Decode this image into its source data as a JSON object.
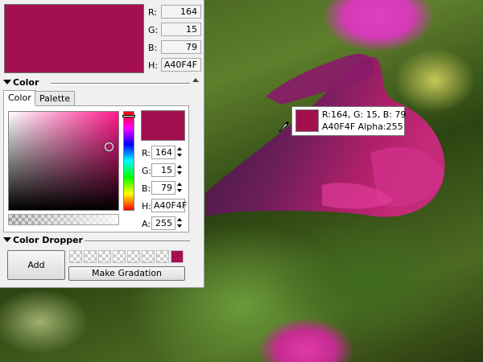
{
  "colors": {
    "current": "#A40F4F",
    "panel_bg": "#f0f0f0"
  },
  "readout": {
    "r_label": "R:",
    "r_value": "164",
    "g_label": "G:",
    "g_value": "15",
    "b_label": "B:",
    "b_value": "79",
    "h_label": "H:",
    "h_value": "A40F4F"
  },
  "color_section": {
    "title": "Color",
    "tabs": [
      {
        "label": "Color"
      },
      {
        "label": "Palette"
      }
    ],
    "r_label": "R:",
    "r_value": "164",
    "g_label": "G:",
    "g_value": "15",
    "b_label": "B:",
    "b_value": "79",
    "h_label": "H:",
    "h_value": "A40F4F",
    "a_label": "A:",
    "a_value": "255"
  },
  "dropper_section": {
    "title": "Color Dropper",
    "add_label": "Add",
    "gradation_label": "Make Gradation"
  },
  "tooltip": {
    "line1": "R:164, G: 15, B: 79",
    "line2": "A40F4F Alpha:255"
  }
}
